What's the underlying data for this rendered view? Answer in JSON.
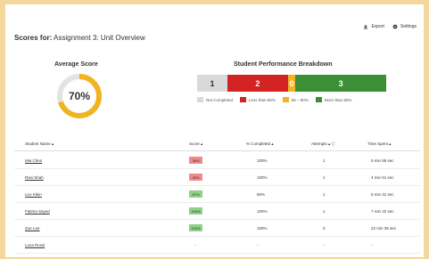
{
  "header": {
    "title_prefix": "Scores for:",
    "title_rest": "Assignment 3: Unit Overview",
    "export_label": "Export",
    "settings_label": "Settings"
  },
  "average": {
    "title": "Average Score",
    "value_label": "70%",
    "value": 0.7,
    "ring_color": "#f2b321",
    "track_color": "#e3e3e3"
  },
  "breakdown": {
    "title": "Student Performance Breakdown",
    "segments": [
      {
        "count": "1",
        "value": 1,
        "color": "#d9d9d9",
        "text_color": "#333333",
        "legend": "Not Completed"
      },
      {
        "count": "2",
        "value": 2,
        "color": "#d32323",
        "text_color": "#ffffff",
        "legend": "Less than 65%"
      },
      {
        "count": "0",
        "value": 0.25,
        "color": "#f2b321",
        "text_color": "#ffffff",
        "legend": "65 – 80%"
      },
      {
        "count": "3",
        "value": 3,
        "color": "#3b8f35",
        "text_color": "#ffffff",
        "legend": "More than 80%"
      }
    ]
  },
  "table": {
    "headers": [
      "Student Name ▴",
      "Score ▴",
      "% Completed ▴",
      "Attempts ▴ ⓘ",
      "Time Spent ▴"
    ],
    "rows": [
      {
        "name": "Mia Chen",
        "score": "36%",
        "score_color": "#f08a8a",
        "completed": "100%",
        "attempts": "1",
        "time": "5 min 59 sec"
      },
      {
        "name": "Ravi Shah",
        "score": "36%",
        "score_color": "#f08a8a",
        "completed": "100%",
        "attempts": "1",
        "time": "4 min 51 sec"
      },
      {
        "name": "Leo Klein",
        "score": "87%",
        "score_color": "#8fd08a",
        "completed": "60%",
        "attempts": "1",
        "time": "5 min 31 sec"
      },
      {
        "name": "Fatima Sayed",
        "score": "100%",
        "score_color": "#8fd08a",
        "completed": "100%",
        "attempts": "1",
        "time": "7 min 22 sec"
      },
      {
        "name": "Zoe Lee",
        "score": "100%",
        "score_color": "#8fd08a",
        "completed": "100%",
        "attempts": "3",
        "time": "22 min 35 sec"
      },
      {
        "name": "Luca Rossi",
        "score": "-",
        "score_color": "",
        "completed": "-",
        "attempts": "-",
        "time": "-"
      }
    ]
  }
}
